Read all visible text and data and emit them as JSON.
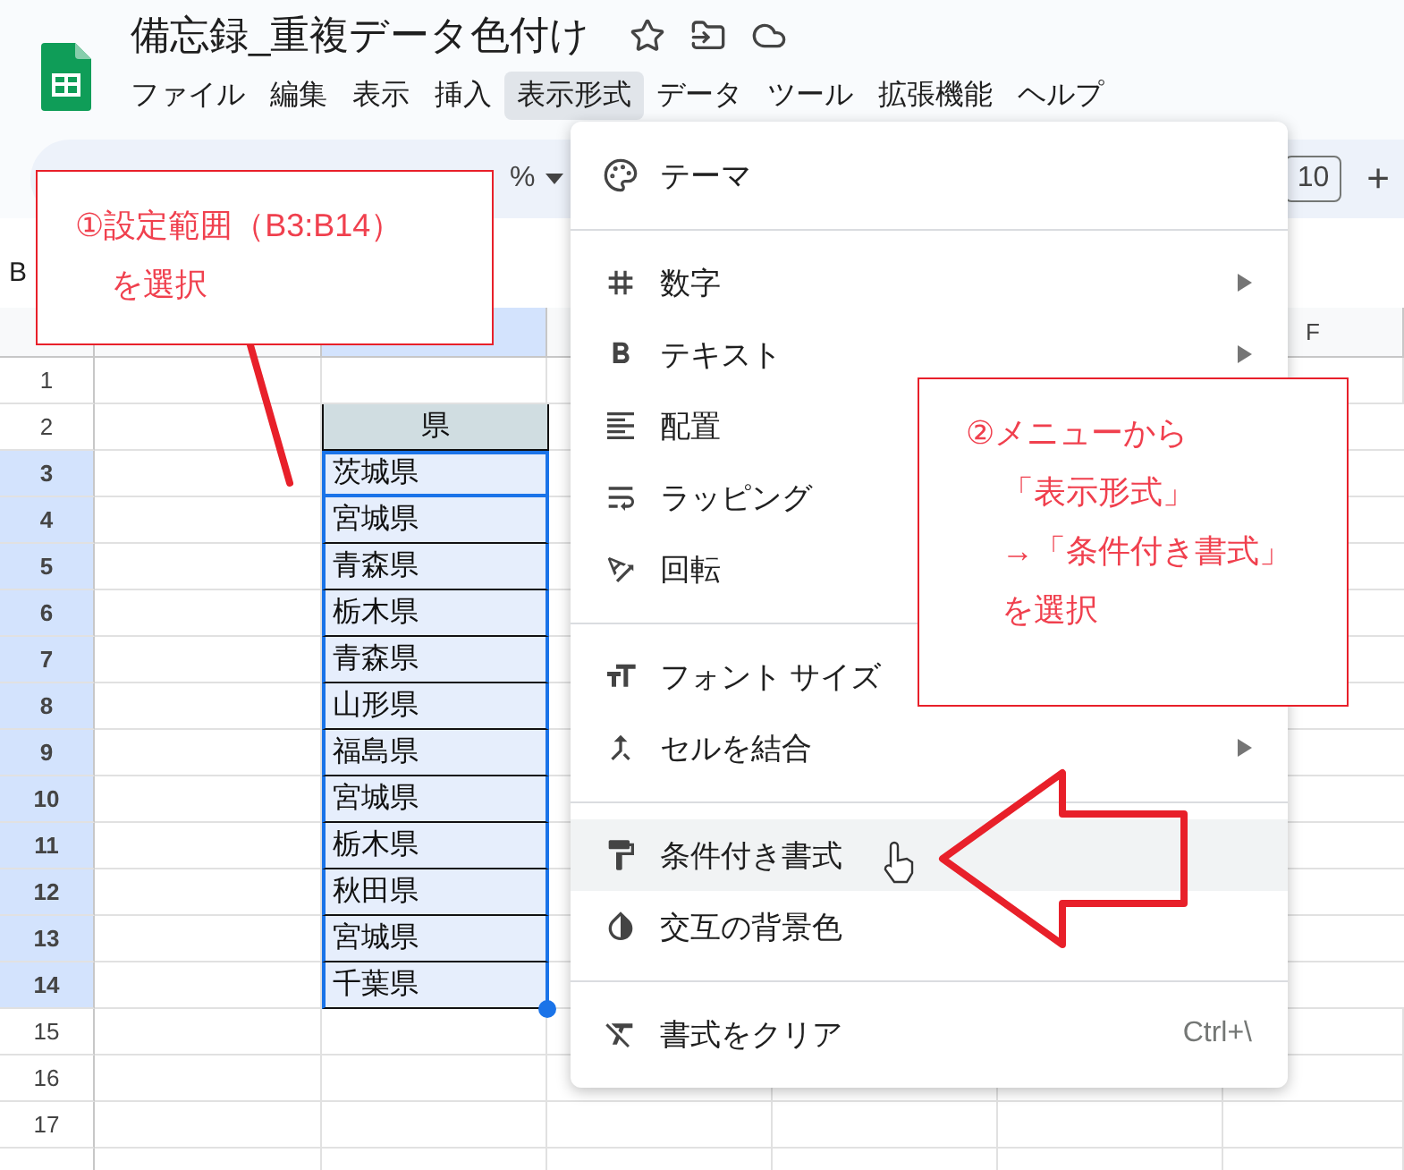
{
  "document": {
    "title": "備忘録_重複データ色付け"
  },
  "menu_bar": [
    {
      "label": "ファイル",
      "selected": false
    },
    {
      "label": "編集",
      "selected": false
    },
    {
      "label": "表示",
      "selected": false
    },
    {
      "label": "挿入",
      "selected": false
    },
    {
      "label": "表示形式",
      "selected": true
    },
    {
      "label": "データ",
      "selected": false
    },
    {
      "label": "ツール",
      "selected": false
    },
    {
      "label": "拡張機能",
      "selected": false
    },
    {
      "label": "ヘルプ",
      "selected": false
    }
  ],
  "toolbar": {
    "zoom": "%",
    "font_size": "10",
    "increase": "+"
  },
  "name_box": "B",
  "columns": [
    {
      "selected": false
    },
    {
      "selected": true
    },
    {
      "selected": false
    },
    {
      "label": "F",
      "selected": false
    }
  ],
  "rows": [
    {
      "number": "1",
      "selected": false
    },
    {
      "number": "2",
      "selected": false,
      "b": {
        "text": "県",
        "kind": "header",
        "active": false
      }
    },
    {
      "number": "3",
      "selected": true,
      "b": {
        "text": "茨城県",
        "kind": "value",
        "active": true
      }
    },
    {
      "number": "4",
      "selected": true,
      "b": {
        "text": "宮城県",
        "kind": "value",
        "active": false
      }
    },
    {
      "number": "5",
      "selected": true,
      "b": {
        "text": "青森県",
        "kind": "value",
        "active": false
      }
    },
    {
      "number": "6",
      "selected": true,
      "b": {
        "text": "栃木県",
        "kind": "value",
        "active": false
      }
    },
    {
      "number": "7",
      "selected": true,
      "b": {
        "text": "青森県",
        "kind": "value",
        "active": false
      }
    },
    {
      "number": "8",
      "selected": true,
      "b": {
        "text": "山形県",
        "kind": "value",
        "active": false
      }
    },
    {
      "number": "9",
      "selected": true,
      "b": {
        "text": "福島県",
        "kind": "value",
        "active": false
      }
    },
    {
      "number": "10",
      "selected": true,
      "b": {
        "text": "宮城県",
        "kind": "value",
        "active": false
      }
    },
    {
      "number": "11",
      "selected": true,
      "b": {
        "text": "栃木県",
        "kind": "value",
        "active": false
      }
    },
    {
      "number": "12",
      "selected": true,
      "b": {
        "text": "秋田県",
        "kind": "value",
        "active": false
      }
    },
    {
      "number": "13",
      "selected": true,
      "b": {
        "text": "宮城県",
        "kind": "value",
        "active": false
      }
    },
    {
      "number": "14",
      "selected": true,
      "b": {
        "text": "千葉県",
        "kind": "value",
        "active": false
      }
    },
    {
      "number": "15",
      "selected": false
    },
    {
      "number": "16",
      "selected": false
    },
    {
      "number": "17",
      "selected": false
    }
  ],
  "format_menu": [
    {
      "kind": "item",
      "label": "テーマ",
      "submenu": false,
      "highlighted": false
    },
    {
      "kind": "separator"
    },
    {
      "kind": "item",
      "label": "数字",
      "submenu": true,
      "highlighted": false
    },
    {
      "kind": "item",
      "label": "テキスト",
      "submenu": true,
      "highlighted": false
    },
    {
      "kind": "item",
      "label": "配置",
      "submenu": false,
      "highlighted": false
    },
    {
      "kind": "item",
      "label": "ラッピング",
      "submenu": false,
      "highlighted": false
    },
    {
      "kind": "item",
      "label": "回転",
      "submenu": false,
      "highlighted": false
    },
    {
      "kind": "separator"
    },
    {
      "kind": "item",
      "label": "フォント サイズ",
      "submenu": false,
      "highlighted": false
    },
    {
      "kind": "item",
      "label": "セルを結合",
      "submenu": true,
      "highlighted": false
    },
    {
      "kind": "separator"
    },
    {
      "kind": "item",
      "label": "条件付き書式",
      "submenu": false,
      "highlighted": true
    },
    {
      "kind": "item",
      "label": "交互の背景色",
      "submenu": false,
      "highlighted": false
    },
    {
      "kind": "separator"
    },
    {
      "kind": "item",
      "label": "書式をクリア",
      "submenu": false,
      "highlighted": false,
      "shortcut": "Ctrl+\\"
    }
  ],
  "callouts": [
    {
      "lines": [
        "①設定範囲（B3:B14）",
        "を選択"
      ]
    },
    {
      "lines": [
        "②メニューから",
        "「表示形式」",
        "→「条件付き書式」",
        "を選択"
      ]
    }
  ]
}
